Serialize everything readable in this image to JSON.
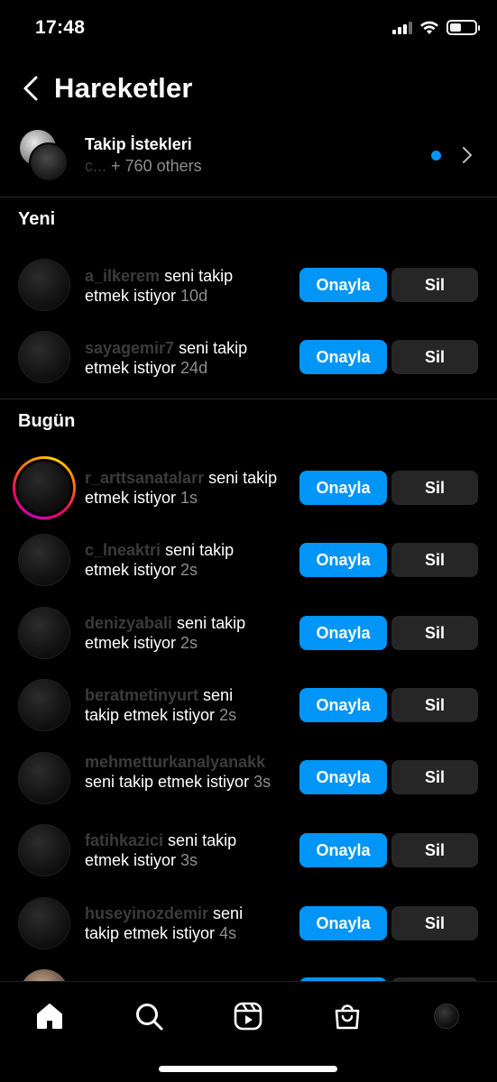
{
  "status_bar": {
    "time": "17:48"
  },
  "header": {
    "title": "Hareketler"
  },
  "follow_requests": {
    "title": "Takip İstekleri",
    "subtitle_user": "c...",
    "subtitle_others": "+ 760 others"
  },
  "sections": {
    "new": "Yeni",
    "today": "Bugün"
  },
  "buttons": {
    "confirm": "Onayla",
    "delete": "Sil"
  },
  "new_requests": [
    {
      "user": "a_ilkerem",
      "text_line1": "seni takip",
      "text_line2": "etmek istiyor",
      "time": "10d"
    },
    {
      "user": "sayagemir7",
      "text_line1": "seni takip",
      "text_line2": "etmek istiyor",
      "time": "24d"
    }
  ],
  "today_requests": [
    {
      "user": "r_arttsanatalarr",
      "text_line1": "seni takip",
      "text_line2": "etmek istiyor",
      "time": "1s"
    },
    {
      "user": "c_lneaktri",
      "text_line1": "seni takip",
      "text_line2": "etmek istiyor",
      "time": "2s"
    },
    {
      "user": "denizyabali",
      "text_line1": "seni takip",
      "text_line2": "etmek istiyor",
      "time": "2s"
    },
    {
      "user": "beratmetinyurt",
      "text_line1": "seni",
      "text_line2": "takip etmek istiyor",
      "time": "2s"
    },
    {
      "user": "mehmetturkanalyanakk",
      "text_line1": "",
      "text_line2": "seni takip etmek istiyor",
      "time": "3s"
    },
    {
      "user": "fatihkazici",
      "text_line1": "seni takip",
      "text_line2": "etmek istiyor",
      "time": "3s"
    },
    {
      "user": "huseyinozdemir",
      "text_line1": "seni",
      "text_line2": "takip etmek istiyor",
      "time": "4s"
    }
  ],
  "tab_bar": {
    "icons": [
      "home-icon",
      "search-icon",
      "reels-icon",
      "shop-icon",
      "profile-avatar"
    ]
  },
  "colors": {
    "accent": "#0095f6",
    "secondary_button": "#262626",
    "muted_text": "#8e8e8e"
  }
}
